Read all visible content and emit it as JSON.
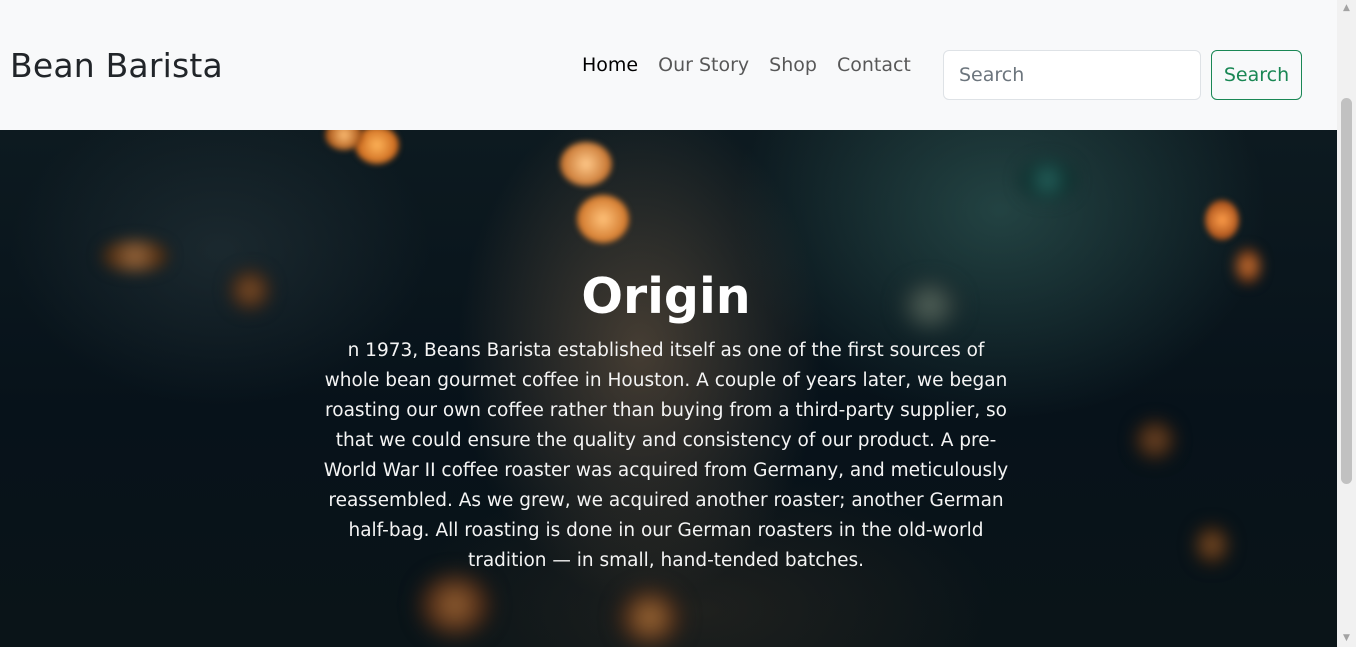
{
  "navbar": {
    "brand": "Bean Barista",
    "links": [
      {
        "label": "Home",
        "active": true
      },
      {
        "label": "Our Story",
        "active": false
      },
      {
        "label": "Shop",
        "active": false
      },
      {
        "label": "Contact",
        "active": false
      }
    ],
    "search": {
      "placeholder": "Search",
      "value": "",
      "button_label": "Search"
    }
  },
  "hero": {
    "title": "Origin",
    "text": "n 1973, Beans Barista established itself as one of the first sources of whole bean gourmet coffee in Houston. A couple of years later, we began roasting our own coffee rather than buying from a third-party supplier, so that we could ensure the quality and consistency of our product. A pre-World War II coffee roaster was acquired from Germany, and meticulously reassembled. As we grew, we acquired another roaster; another German half-bag. All roasting is done in our German roasters in the old-world tradition — in small, hand-tended batches."
  },
  "scrollbar": {
    "up_icon": "scroll-up-arrow-icon",
    "down_icon": "scroll-down-arrow-icon"
  },
  "colors": {
    "navbar_bg": "#f8f9fa",
    "search_button": "#198754",
    "hero_text": "#ffffff"
  }
}
